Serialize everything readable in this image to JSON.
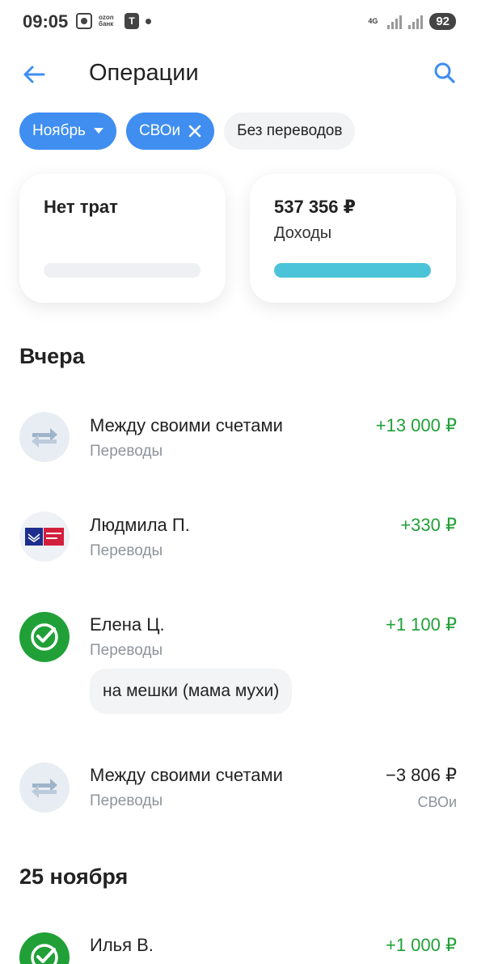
{
  "status_bar": {
    "time": "09:05",
    "ozon_label": "ozon банк",
    "t_label": "Т",
    "network": "4G",
    "battery": "92"
  },
  "header": {
    "title": "Операции"
  },
  "filters": [
    {
      "label": "Ноябрь",
      "kind": "dropdown"
    },
    {
      "label": "СВОи",
      "kind": "removable"
    },
    {
      "label": "Без переводов",
      "kind": "toggle"
    }
  ],
  "summary": {
    "expenses": {
      "label": "Нет трат",
      "progress": 0
    },
    "income": {
      "amount": "537 356 ₽",
      "label": "Доходы",
      "progress": 1.0,
      "color": "#4bc4d9"
    }
  },
  "sections": [
    {
      "title": "Вчера",
      "transactions": [
        {
          "name": "Между своими счетами",
          "category": "Переводы",
          "amount": "+13 000 ₽",
          "icon": "transfer-icon"
        },
        {
          "name": "Людмила П.",
          "category": "Переводы",
          "amount": "+330 ₽",
          "icon": "pochta-bank-logo"
        },
        {
          "name": "Елена Ц.",
          "category": "Переводы",
          "amount": "+1 100 ₽",
          "icon": "sber-logo",
          "comment": "на мешки (мама мухи)"
        },
        {
          "name": "Между своими счетами",
          "category": "Переводы",
          "amount": "−3 806 ₽",
          "icon": "transfer-icon",
          "tag": "СВОи"
        }
      ]
    },
    {
      "title": "25 ноября",
      "transactions": [
        {
          "name": "Илья В.",
          "amount": "+1 000 ₽",
          "icon": "sber-logo"
        }
      ]
    }
  ],
  "colors": {
    "accent": "#3f8ef0",
    "positive": "#21a038",
    "muted": "#8d949c"
  }
}
